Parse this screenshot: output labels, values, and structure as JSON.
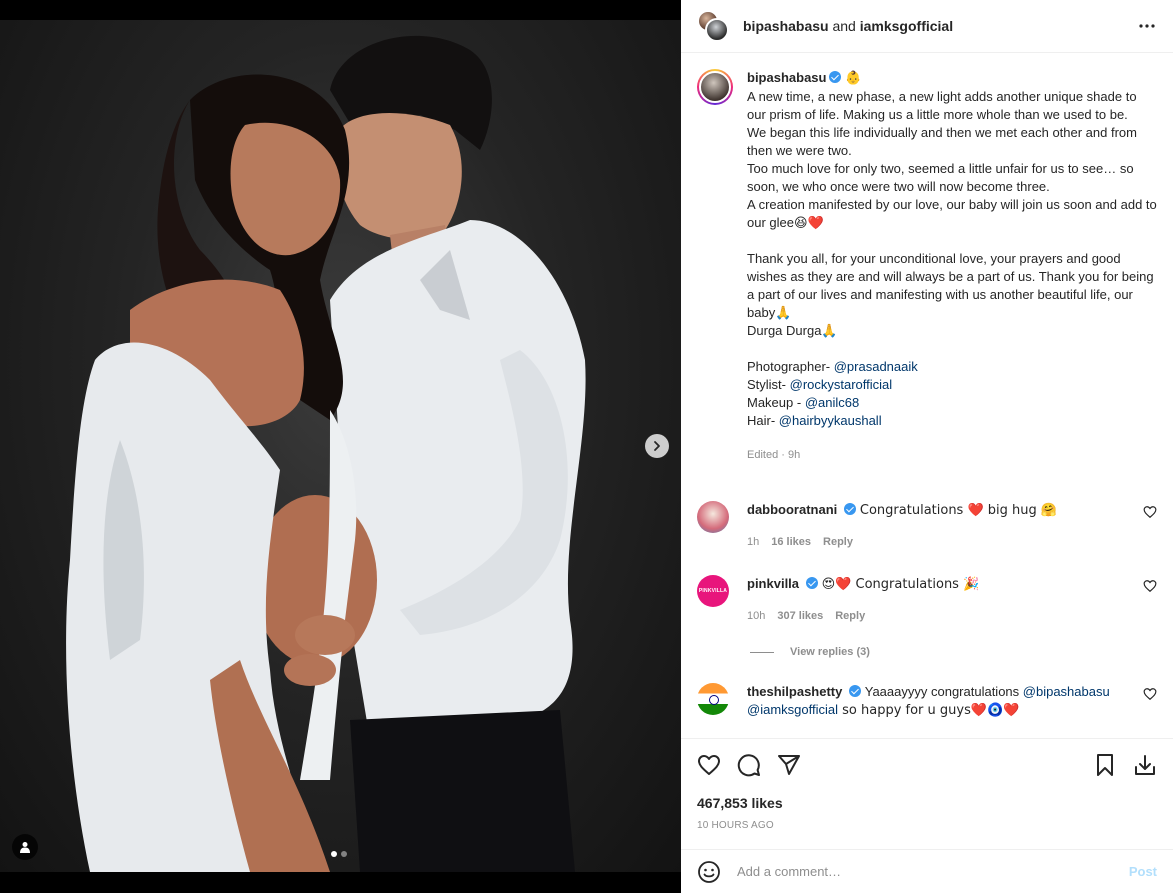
{
  "header": {
    "user1": "bipashabasu",
    "and": "and",
    "user2": "iamksgofficial"
  },
  "caption": {
    "username": "bipashabasu",
    "badge_emoji": "👶",
    "lines": [
      "A new time, a new phase, a new light adds another unique shade to our prism of life. Making us a little more whole than we used to be.",
      "We began this life individually and then we met each other and from then we were two.",
      "Too much love for only two, seemed a little unfair for us to see… so soon, we who once were two will now become three.",
      "A creation manifested by our love, our baby will join us soon and add to our glee😆❤️",
      "",
      "Thank you all, for your unconditional love, your prayers and good wishes as they are and will always be a part of us. Thank you for being a part of our lives and manifesting with us another beautiful life, our baby🙏",
      "Durga Durga🙏",
      ""
    ],
    "credits": [
      {
        "role": "Photographer- ",
        "handle": "@prasadnaaik"
      },
      {
        "role": "Stylist- ",
        "handle": "@rockystarofficial"
      },
      {
        "role": "Makeup - ",
        "handle": "@anilc68"
      },
      {
        "role": "Hair- ",
        "handle": "@hairbyykaushall"
      }
    ],
    "edited": "Edited · 9h"
  },
  "comments": [
    {
      "user": "dabbooratnani",
      "text": "Congratulations ❤️ big hug 🤗",
      "time": "1h",
      "likes": "16 likes",
      "reply": "Reply"
    },
    {
      "user": "pinkvilla",
      "avatar_text": "PINKVILLA",
      "text": "😍❤️ Congratulations 🎉",
      "time": "10h",
      "likes": "307 likes",
      "reply": "Reply"
    },
    {
      "user": "theshilpashetty",
      "text": "Yaaaayyyy congratulations ",
      "mention1": "@bipashabasu",
      "mention2": "@iamksgofficial",
      "text2": " so happy for u guys❤️🧿❤️"
    }
  ],
  "view_replies": "View replies (3)",
  "likes": "467,853 likes",
  "time_ago": "10 HOURS AGO",
  "add_comment": {
    "placeholder": "Add a comment…",
    "post": "Post"
  },
  "carousel": {
    "current_slide": 1,
    "total_slides": 2
  },
  "colors": {
    "link": "#00376b",
    "verified": "#3897f0",
    "post_disabled": "#b2dffc",
    "pinkvilla": "#e8157c"
  }
}
